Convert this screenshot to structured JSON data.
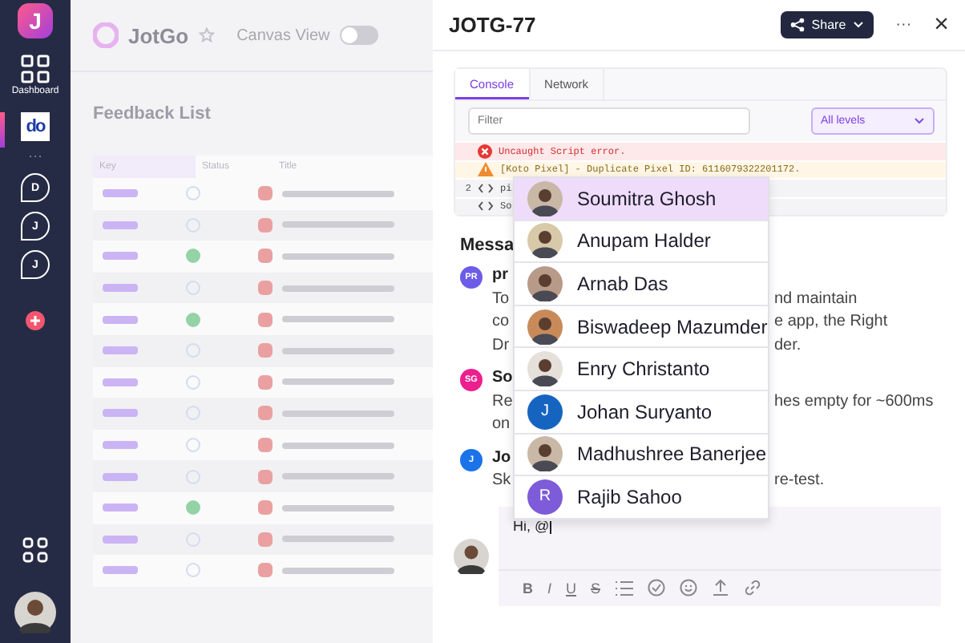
{
  "sidebar": {
    "logo": "J",
    "dashboard_label": "Dashboard",
    "workspace_logo": "do",
    "more": "···",
    "chats": [
      {
        "initial": "D"
      },
      {
        "initial": "J"
      },
      {
        "initial": "J"
      }
    ]
  },
  "background": {
    "app_name": "JotGo",
    "canvas_view_label": "Canvas View",
    "canvas_view_on": false,
    "page_title": "Feedback List",
    "table": {
      "columns": [
        "Key",
        "Status",
        "Title"
      ],
      "rows": [
        {
          "done": false
        },
        {
          "done": false
        },
        {
          "done": true
        },
        {
          "done": false
        },
        {
          "done": true
        },
        {
          "done": false
        },
        {
          "done": false
        },
        {
          "done": false
        },
        {
          "done": false
        },
        {
          "done": false
        },
        {
          "done": true
        },
        {
          "done": false
        },
        {
          "done": false
        }
      ]
    }
  },
  "panel": {
    "title": "JOTG-77",
    "share_label": "Share",
    "more": "···",
    "close": "×",
    "console": {
      "tabs": [
        {
          "label": "Console",
          "selected": true
        },
        {
          "label": "Network",
          "selected": false
        }
      ],
      "filter": {
        "placeholder": "Filter"
      },
      "level_select": "All levels",
      "logs": [
        {
          "kind": "error",
          "text": "Uncaught Script error."
        },
        {
          "kind": "warning",
          "text": "[Koto Pixel] - Duplicate Pixel ID: 6116079322201172."
        },
        {
          "kind": "source",
          "line": "2",
          "text": "pi"
        },
        {
          "kind": "source",
          "text": "So"
        }
      ]
    },
    "messages_heading": "Messa",
    "messages": [
      {
        "initials": "PR",
        "color": "#6c5ce7",
        "author": "pr",
        "lines": [
          {
            "left": "To",
            "right": "nd maintain"
          },
          {
            "left": "co",
            "right": "e app, the Right"
          },
          {
            "left": "Dr",
            "right": "der."
          }
        ]
      },
      {
        "initials": "SG",
        "color": "#ec1f8e",
        "author": "So",
        "lines": [
          {
            "left": "Re",
            "right": "hes empty for ~600ms"
          },
          {
            "left": "on"
          }
        ]
      },
      {
        "initials": "J",
        "color": "#1a73e8",
        "author": "Jo",
        "lines": [
          {
            "left": "Sk",
            "right": "re-test."
          }
        ]
      }
    ],
    "composer": {
      "value": "Hi, @",
      "toolbar": [
        {
          "kind": "bold",
          "label": "B"
        },
        {
          "kind": "italic",
          "label": "I"
        },
        {
          "kind": "underline",
          "label": "U"
        },
        {
          "kind": "strike",
          "label": "S"
        }
      ]
    },
    "mentions": [
      {
        "name": "Soumitra Ghosh",
        "kind": "photo",
        "selected": true
      },
      {
        "name": "Anupam Halder",
        "kind": "photo",
        "selected": false
      },
      {
        "name": "Arnab Das",
        "kind": "photo",
        "selected": false
      },
      {
        "name": "Biswadeep Mazumder",
        "kind": "photo",
        "selected": false
      },
      {
        "name": "Enry Christanto",
        "kind": "photo",
        "selected": false
      },
      {
        "name": "Johan Suryanto",
        "kind": "letter",
        "initial": "J",
        "color": "#1565c0",
        "selected": false
      },
      {
        "name": "Madhushree Banerjee",
        "kind": "photo",
        "selected": false
      },
      {
        "name": "Rajib Sahoo",
        "kind": "letter",
        "initial": "R",
        "color": "#7e5bd8",
        "selected": false
      }
    ]
  }
}
